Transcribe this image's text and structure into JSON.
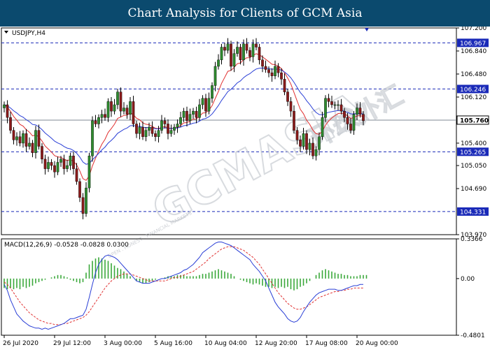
{
  "banner": {
    "title": "Chart Analysis for Clients of GCM Asia"
  },
  "watermark": {
    "brand": "GCMASIA",
    "tagline": "OPEN . HONEST . FINANCIAL MARKETS",
    "zh": "环球外汇"
  },
  "colors": {
    "banner": "#0b4a6e",
    "candle_up": "#2e8b2e",
    "candle_down": "#8b1a1a",
    "ma_fast": "#e03030",
    "ma_slow": "#2a3fd6",
    "hline": "#1a2ab8",
    "price_line": "#7f8a93",
    "histogram": "#3aa83a",
    "macd_signal": "#e03030",
    "macd_line": "#2a3fd6"
  },
  "chart_data": [
    {
      "type": "candlestick",
      "title": "USDJPY,H4",
      "ylim": [
        103.97,
        107.2
      ],
      "y_ticks": [
        "107.200",
        "106.840",
        "106.480",
        "106.120",
        "105.400",
        "105.050",
        "104.690",
        "103.970"
      ],
      "x_ticks": [
        "26 Jul 2020",
        "29 Jul 12:00",
        "3 Aug 00:00",
        "5 Aug 16:00",
        "10 Aug 04:00",
        "12 Aug 20:00",
        "17 Aug 08:00",
        "20 Aug 00:00"
      ],
      "x_tick_index": [
        0,
        16,
        32,
        48,
        64,
        80,
        96,
        112
      ],
      "current_price": 105.76,
      "levels": [
        106.967,
        106.246,
        105.265,
        104.331
      ],
      "level_labels": [
        "106.967",
        "106.246",
        "105.265",
        "104.331"
      ],
      "current_price_label": "105.760",
      "close": [
        106.0,
        105.8,
        105.6,
        105.45,
        105.5,
        105.4,
        105.55,
        105.35,
        105.4,
        105.25,
        105.6,
        105.35,
        105.15,
        105.0,
        105.1,
        105.05,
        104.95,
        105.1,
        105.15,
        105.0,
        105.05,
        105.2,
        105.0,
        104.8,
        104.55,
        104.3,
        104.7,
        105.2,
        105.75,
        105.7,
        105.8,
        105.85,
        105.8,
        106.05,
        105.9,
        106.0,
        106.2,
        105.9,
        105.95,
        105.85,
        106.05,
        105.7,
        105.55,
        105.65,
        105.5,
        105.6,
        105.65,
        105.55,
        105.5,
        105.6,
        105.75,
        105.7,
        105.55,
        105.6,
        105.65,
        105.7,
        105.8,
        105.9,
        105.75,
        105.85,
        105.9,
        105.8,
        106.0,
        106.1,
        105.9,
        106.1,
        106.3,
        106.6,
        106.7,
        106.9,
        106.85,
        106.95,
        106.6,
        106.8,
        106.9,
        106.7,
        106.95,
        106.85,
        106.75,
        106.95,
        106.9,
        106.7,
        106.6,
        106.55,
        106.5,
        106.45,
        106.6,
        106.5,
        106.4,
        106.2,
        106.05,
        105.9,
        105.6,
        105.45,
        105.35,
        105.55,
        105.3,
        105.4,
        105.2,
        105.3,
        105.5,
        105.8,
        106.1,
        106.05,
        106.0,
        106.0,
        106.0,
        105.9,
        105.8,
        105.7,
        105.6,
        105.85,
        105.95,
        105.85,
        105.75
      ],
      "series": [
        {
          "name": "MA fast"
        },
        {
          "name": "MA slow"
        }
      ]
    },
    {
      "type": "macd",
      "title": "MACD(12,26,9) -0.0528 -0.0828 0.0300",
      "ylim": [
        -0.4801,
        0.3366
      ],
      "y_ticks": [
        "0.3366",
        "0.00",
        "-0.4801"
      ],
      "histogram": [
        -0.08,
        -0.09,
        -0.08,
        -0.09,
        -0.08,
        -0.09,
        -0.07,
        -0.08,
        -0.07,
        -0.06,
        -0.04,
        -0.03,
        -0.02,
        -0.01,
        0.0,
        0.01,
        0.02,
        0.03,
        0.03,
        0.02,
        0.01,
        -0.01,
        -0.02,
        -0.03,
        -0.04,
        -0.03,
        0.05,
        0.12,
        0.15,
        0.17,
        0.18,
        0.17,
        0.16,
        0.15,
        0.13,
        0.11,
        0.09,
        0.08,
        0.06,
        0.04,
        0.02,
        0.0,
        -0.02,
        -0.03,
        -0.04,
        -0.04,
        -0.03,
        -0.02,
        -0.01,
        0.0,
        0.0,
        0.01,
        0.02,
        0.02,
        0.02,
        0.03,
        0.03,
        0.03,
        0.02,
        0.02,
        0.02,
        0.02,
        0.03,
        0.04,
        0.04,
        0.05,
        0.06,
        0.07,
        0.08,
        0.07,
        0.06,
        0.05,
        0.04,
        0.02,
        0.0,
        -0.01,
        -0.02,
        -0.03,
        -0.04,
        -0.05,
        -0.04,
        -0.05,
        -0.06,
        -0.07,
        -0.07,
        -0.08,
        -0.07,
        -0.08,
        -0.07,
        -0.08,
        -0.07,
        -0.09,
        -0.1,
        -0.09,
        -0.07,
        -0.06,
        -0.04,
        -0.02,
        0.0,
        0.03,
        0.05,
        0.07,
        0.08,
        0.07,
        0.06,
        0.05,
        0.04,
        0.04,
        0.03,
        0.03,
        0.02,
        0.02,
        0.02,
        0.03,
        0.03,
        0.03
      ],
      "macd": [
        -0.05,
        -0.1,
        -0.18,
        -0.24,
        -0.3,
        -0.33,
        -0.36,
        -0.38,
        -0.4,
        -0.41,
        -0.42,
        -0.42,
        -0.43,
        -0.42,
        -0.43,
        -0.42,
        -0.41,
        -0.4,
        -0.39,
        -0.38,
        -0.36,
        -0.34,
        -0.34,
        -0.33,
        -0.32,
        -0.31,
        -0.26,
        -0.16,
        -0.05,
        0.05,
        0.12,
        0.16,
        0.19,
        0.2,
        0.19,
        0.18,
        0.16,
        0.13,
        0.1,
        0.07,
        0.04,
        0.01,
        -0.02,
        -0.03,
        -0.04,
        -0.04,
        -0.04,
        -0.03,
        -0.02,
        -0.01,
        0.0,
        0.0,
        0.01,
        0.02,
        0.03,
        0.04,
        0.05,
        0.07,
        0.08,
        0.1,
        0.12,
        0.15,
        0.18,
        0.22,
        0.24,
        0.26,
        0.28,
        0.3,
        0.31,
        0.31,
        0.3,
        0.29,
        0.28,
        0.26,
        0.24,
        0.22,
        0.2,
        0.18,
        0.16,
        0.12,
        0.09,
        0.06,
        0.02,
        -0.02,
        -0.08,
        -0.14,
        -0.2,
        -0.24,
        -0.27,
        -0.3,
        -0.34,
        -0.36,
        -0.37,
        -0.36,
        -0.33,
        -0.28,
        -0.24,
        -0.2,
        -0.17,
        -0.14,
        -0.12,
        -0.11,
        -0.1,
        -0.09,
        -0.09,
        -0.09,
        -0.1,
        -0.1,
        -0.09,
        -0.08,
        -0.07,
        -0.06,
        -0.06,
        -0.05,
        -0.05
      ],
      "signal": [
        -0.03,
        -0.05,
        -0.08,
        -0.12,
        -0.16,
        -0.2,
        -0.23,
        -0.26,
        -0.29,
        -0.31,
        -0.33,
        -0.35,
        -0.36,
        -0.37,
        -0.38,
        -0.38,
        -0.39,
        -0.39,
        -0.39,
        -0.38,
        -0.38,
        -0.37,
        -0.36,
        -0.35,
        -0.34,
        -0.33,
        -0.31,
        -0.28,
        -0.24,
        -0.2,
        -0.16,
        -0.12,
        -0.08,
        -0.05,
        -0.02,
        0.0,
        0.02,
        0.03,
        0.04,
        0.04,
        0.04,
        0.03,
        0.02,
        0.01,
        0.0,
        -0.01,
        -0.02,
        -0.02,
        -0.02,
        -0.02,
        -0.02,
        -0.02,
        -0.01,
        0.0,
        0.01,
        0.01,
        0.02,
        0.03,
        0.04,
        0.05,
        0.06,
        0.08,
        0.1,
        0.12,
        0.14,
        0.17,
        0.19,
        0.21,
        0.23,
        0.25,
        0.26,
        0.27,
        0.27,
        0.27,
        0.26,
        0.25,
        0.24,
        0.22,
        0.2,
        0.18,
        0.15,
        0.12,
        0.08,
        0.04,
        0.0,
        -0.04,
        -0.08,
        -0.12,
        -0.15,
        -0.18,
        -0.21,
        -0.23,
        -0.25,
        -0.26,
        -0.26,
        -0.25,
        -0.24,
        -0.22,
        -0.2,
        -0.18,
        -0.16,
        -0.15,
        -0.14,
        -0.13,
        -0.12,
        -0.11,
        -0.11,
        -0.1,
        -0.1,
        -0.09,
        -0.09,
        -0.08,
        -0.08,
        -0.08,
        -0.08
      ]
    }
  ]
}
